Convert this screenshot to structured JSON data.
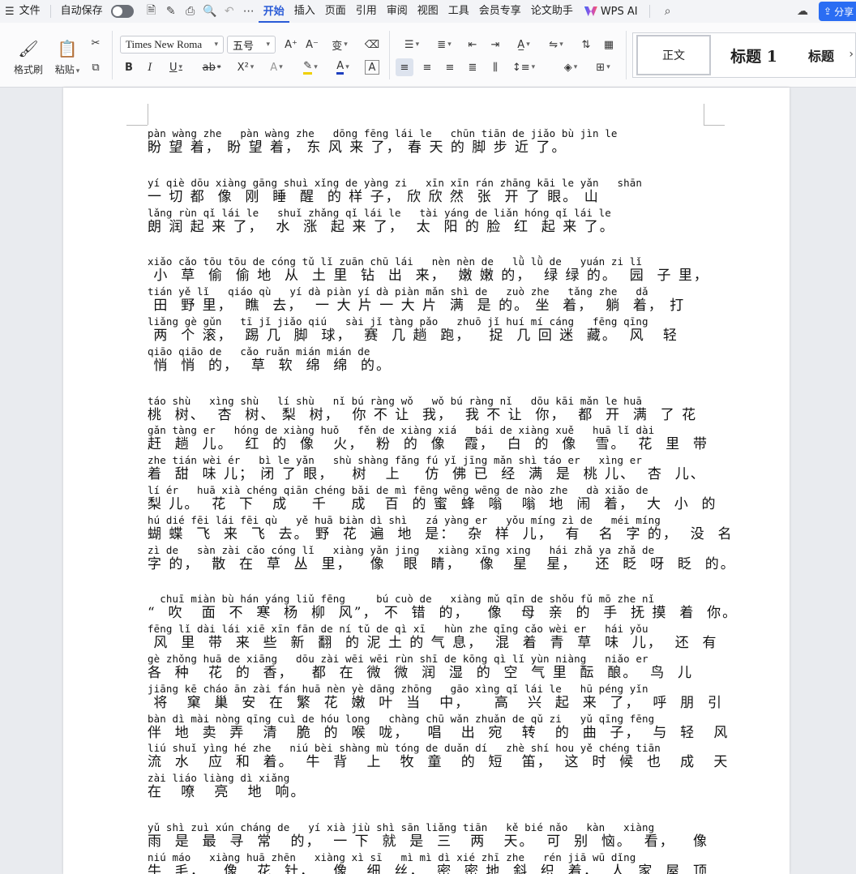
{
  "menubar": {
    "items": [
      "文件",
      "自动保存",
      "开始",
      "插入",
      "页面",
      "引用",
      "审阅",
      "视图",
      "工具",
      "会员专享",
      "论文助手",
      "WPS AI"
    ],
    "share_label": "分享"
  },
  "ribbon": {
    "format_painter": "格式刷",
    "paste": "粘贴",
    "font_name": "Times New Roma",
    "font_size": "五号",
    "styles": {
      "normal": "正文",
      "heading1": "标题 1",
      "heading": "标题"
    }
  },
  "document": {
    "paragraphs": [
      [
        {
          "py": "pàn wàng zhe   pàn wàng zhe   dōng fēng lái le   chūn tiān de jiǎo bù jìn le",
          "hz": "盼 望 着， 盼 望 着， 东 风 来 了， 春 天 的 脚 步 近 了。"
        }
      ],
      [
        {
          "py": "yí qiè dōu xiàng gāng shuì xǐng de yàng zi   xīn xīn rán zhāng kāi le yǎn   shān",
          "hz": "一 切 都  像  刚  睡  醒  的 样 子， 欣 欣 然  张  开 了 眼。 山"
        },
        {
          "py": "lǎng rùn qǐ lái le   shuǐ zhǎng qǐ lái le   tài yáng de liǎn hóng qǐ lái le",
          "hz": "朗 润 起 来 了，  水  涨  起 来 了，  太  阳 的 脸  红  起 来 了。"
        }
      ],
      [
        {
          "py": "xiǎo cǎo tōu tōu de cóng tǔ lǐ zuān chū lái   nèn nèn de   lǜ lǜ de   yuán zi lǐ",
          "hz": " 小  草  偷  偷 地  从  土 里  钻  出  来，  嫩 嫩 的，  绿 绿 的。  园  子 里，"
        },
        {
          "py": "tián yě lǐ   qiáo qù   yí dà piàn yí dà piàn mǎn shì de   zuò zhe   tǎng zhe   dǎ",
          "hz": " 田  野 里，  瞧  去，  一 大 片 一 大 片  满  是 的。 坐  着，  躺  着， 打"
        },
        {
          "py": "liǎng gè gǔn   tī jǐ jiǎo qiú   sài jǐ tàng pǎo   zhuō jǐ huí mí cáng   fēng qīng",
          "hz": " 两  个 滚，  踢 几  脚  球，  赛  几 趟  跑，   捉  几 回 迷  藏。  风   轻"
        },
        {
          "py": "qiāo qiāo de   cǎo ruǎn mián mián de",
          "hz": " 悄  悄  的，  草  软  绵  绵  的。"
        }
      ],
      [
        {
          "py": "táo shù   xìng shù   lí shù   nǐ bú ràng wǒ   wǒ bú ràng nǐ   dōu kāi mǎn le huā",
          "hz": "桃  树、  杏  树、 梨  树，  你 不 让  我，  我 不 让  你，  都  开  满  了 花"
        },
        {
          "py": "gǎn tàng er   hóng de xiàng huǒ   fěn de xiàng xiá   bái de xiàng xuě   huā lǐ dài",
          "hz": "赶  趟  儿。  红  的  像   火，  粉  的  像   霞，  白  的  像   雪。  花  里  带"
        },
        {
          "py": "zhe tián wèi ér   bì le yǎn   shù shàng fǎng fú yǐ jīng mǎn shì táo er   xìng er",
          "hz": "着  甜  味 儿； 闭 了 眼，   树   上    仿  佛 已  经  满  是  桃 儿、  杏  儿、"
        },
        {
          "py": "lí ér   huā xià chéng qiān chéng bǎi de mì fēng wēng wēng de nào zhe   dà xiǎo de",
          "hz": "梨 儿。  花  下   成    千    成   百  的 蜜  蜂  嗡   嗡  地  闹  着，  大  小  的"
        },
        {
          "py": "hú dié fēi lái fēi qù   yě huā biàn dì shì   zá yàng er   yǒu míng zì de   méi míng",
          "hz": "蝴 蝶  飞  来  飞  去。 野  花  遍  地  是：  杂  样  儿，  有   名  字 的，  没  名"
        },
        {
          "py": "zì de   sàn zài cǎo cóng lǐ   xiàng yǎn jing   xiàng xīng xing   hái zhǎ ya zhǎ de",
          "hz": "字 的，  散  在  草  丛  里，   像   眼  睛，   像   星   星，   还  眨  呀  眨  的。"
        }
      ],
      [
        {
          "py": "  chuī miàn bù hán yáng liǔ fēng     bú cuò de   xiàng mǔ qīn de shǒu fǔ mō zhe nǐ",
          "hz": "“  吹   面  不  寒  杨  柳  风”， 不  错  的，   像   母  亲  的  手  抚 摸  着  你。"
        },
        {
          "py": "fēng lǐ dài lái xiē xīn fān de ní tǔ de qì xī   hùn zhe qīng cǎo wèi er   hái yǒu",
          "hz": " 风  里  带  来  些  新  翻  的 泥 土 的 气 息，  混  着  青  草  味  儿，  还  有"
        },
        {
          "py": "gè zhǒng huā de xiāng   dōu zài wēi wēi rùn shī de kōng qì lǐ yùn niàng   niǎo er",
          "hz": "各  种   花  的  香，   都  在  微  微  润  湿  的  空  气 里  酝  酿。  鸟  儿"
        },
        {
          "py": "jiāng kē cháo ān zài fán huā nèn yè dāng zhōng   gāo xìng qǐ lái le   hū péng yǐn",
          "hz": " 将   窠  巢  安  在  繁  花  嫩  叶  当   中，    高   兴  起  来  了，  呼  朋  引"
        },
        {
          "py": "bàn dì mài nòng qīng cuì de hóu long   chàng chū wǎn zhuǎn de qǔ zi   yǔ qīng fēng",
          "hz": "伴  地  卖  弄   清   脆  的  喉  咙，   唱   出  宛   转   的  曲  子，  与  轻   风"
        },
        {
          "py": "liú shuǐ yìng hé zhe   niú bèi shàng mù tóng de duǎn dí   zhè shí hou yě chéng tiān",
          "hz": "流  水   应  和  着。  牛  背   上   牧  童   的  短   笛，  这  时  候  也   成   天"
        },
        {
          "py": "zài liáo liàng dì xiǎng",
          "hz": "在   嘹   亮   地  响。"
        }
      ],
      [
        {
          "py": "yǔ shì zuì xún cháng de   yí xià jiù shì sān liǎng tiān   kě bié nǎo   kàn   xiàng",
          "hz": "雨  是  最  寻  常   的，  一 下  就  是  三   两   天。  可  别  恼。  看，   像"
        },
        {
          "py": "niú máo   xiàng huā zhēn   xiàng xì sī   mì mì dì xié zhī zhe   rén jiā wū dǐng",
          "hz": "牛  毛，   像   花  针，   像   细  丝，  密  密 地  斜  织  着，  人  家  屋  顶"
        }
      ]
    ]
  }
}
